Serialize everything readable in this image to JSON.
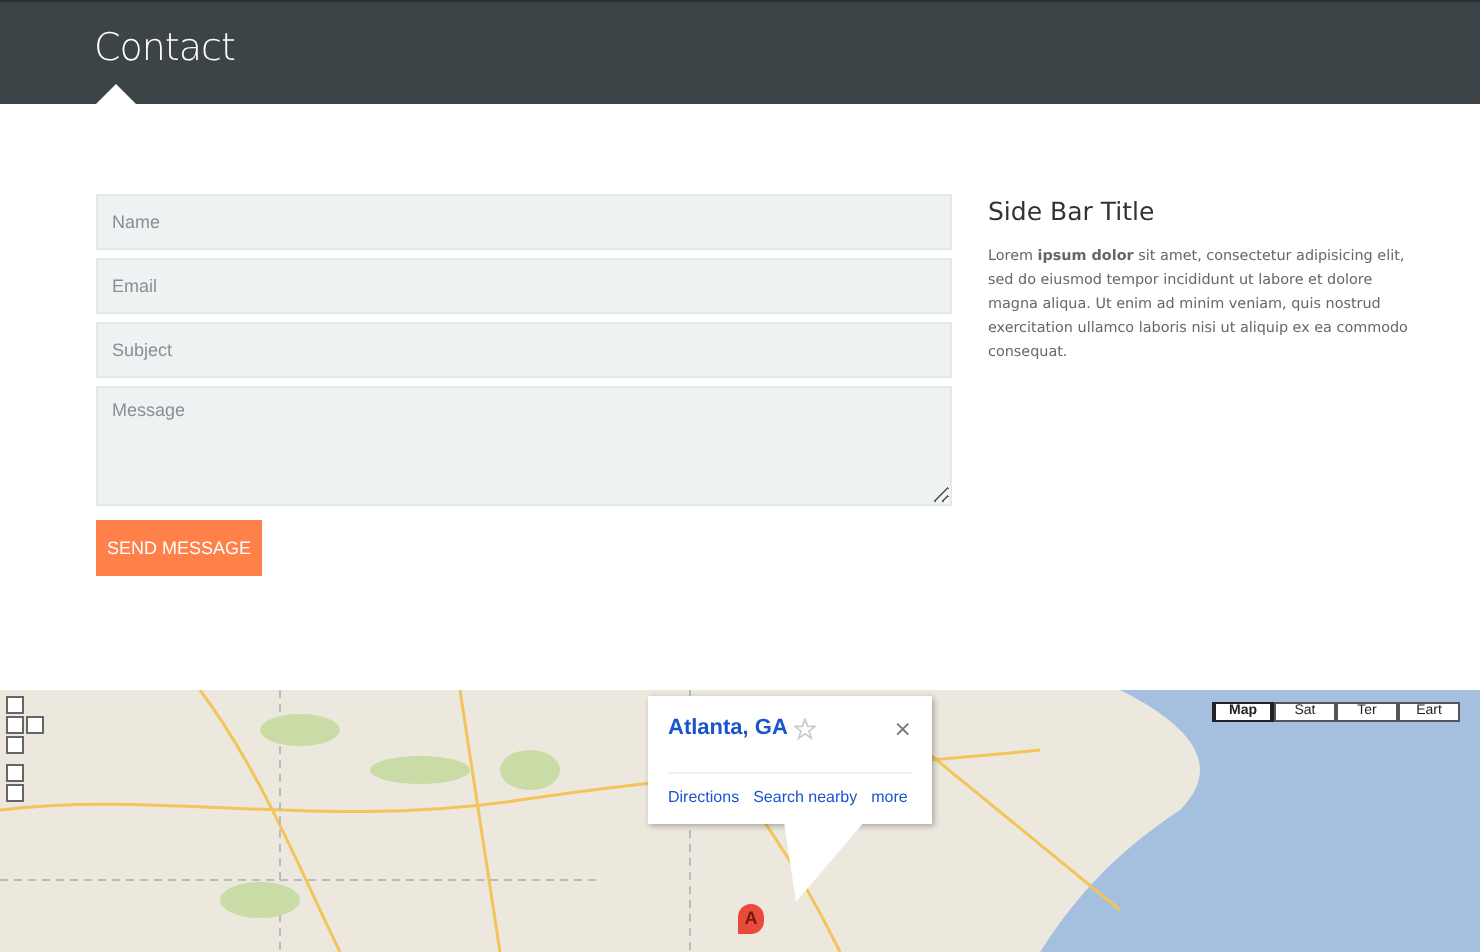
{
  "header": {
    "title": "Contact"
  },
  "form": {
    "fields": [
      {
        "kind": "input",
        "placeholder": "Name"
      },
      {
        "kind": "input",
        "placeholder": "Email"
      },
      {
        "kind": "input",
        "placeholder": "Subject"
      },
      {
        "kind": "textarea",
        "placeholder": "Message"
      }
    ],
    "submit": "SEND MESSAGE"
  },
  "sidebar": {
    "title": "Side Bar Title",
    "text": "Lorem **ipsum dolor** sit amet, consectetur adipisicing elit, sed do eiusmod tempor incididunt ut labore et dolore magna aliqua. Ut enim ad minim veniam, quis nostrud exercitation ullamco laboris nisi ut aliquip ex ea commodo consequat."
  },
  "map": {
    "info_window": {
      "title": "Atlanta, GA",
      "links": [
        "Directions",
        "Search nearby",
        "more"
      ],
      "close": "×"
    },
    "marker": "A",
    "map_types": [
      {
        "label": "Map",
        "selected": true
      },
      {
        "label": "Sat",
        "selected": false
      },
      {
        "label": "Ter",
        "selected": false
      },
      {
        "label": "Eart",
        "selected": false
      }
    ]
  }
}
